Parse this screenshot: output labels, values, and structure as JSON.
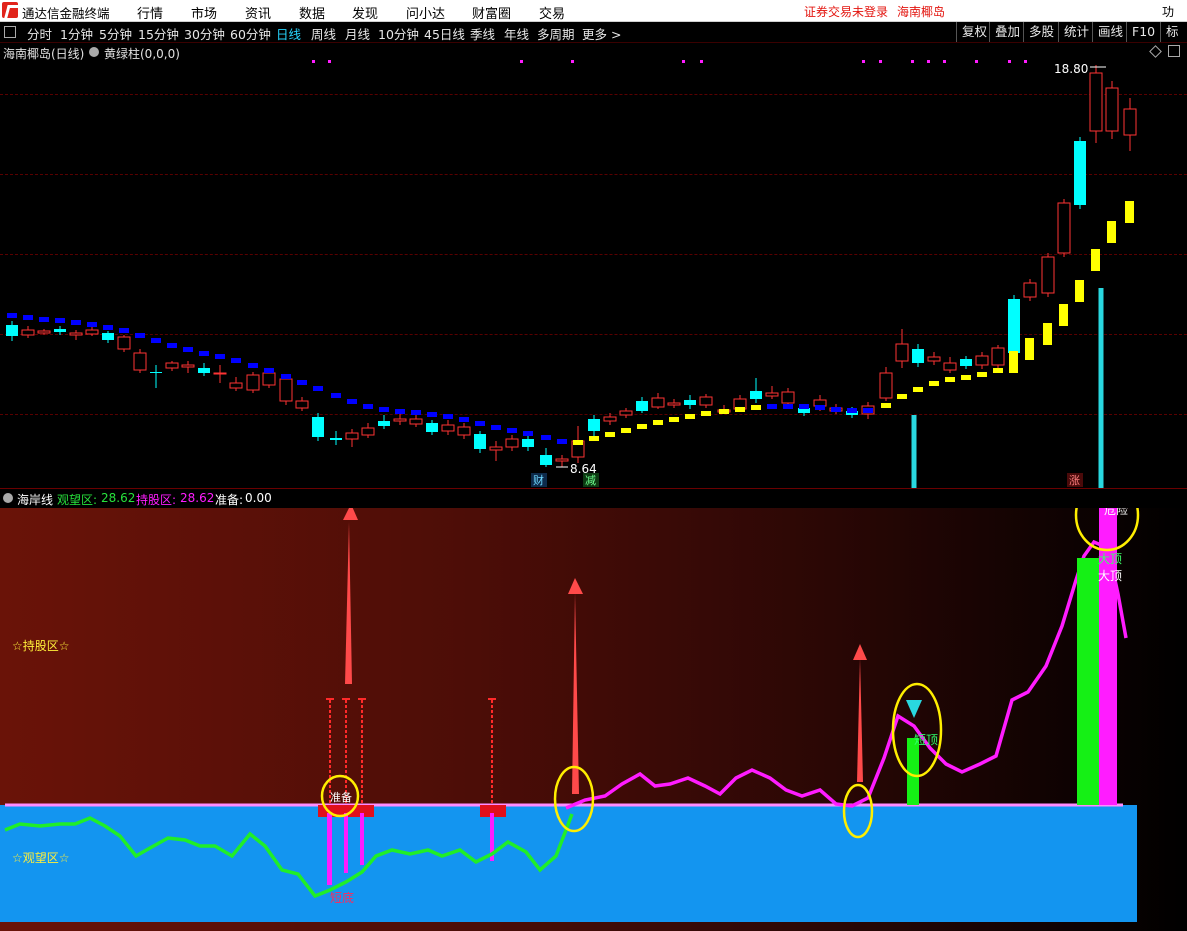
{
  "app": {
    "title": "通达信金融终端",
    "menu": [
      "行情",
      "市场",
      "资讯",
      "数据",
      "发现",
      "问小达",
      "财富圈",
      "交易"
    ],
    "warning": "证券交易未登录",
    "stock_name": "海南椰岛",
    "right_cut": "功"
  },
  "periods": [
    "分时",
    "1分钟",
    "5分钟",
    "15分钟",
    "30分钟",
    "60分钟",
    "日线",
    "周线",
    "月线",
    "10分钟",
    "45日线",
    "季线",
    "年线",
    "多周期",
    "更多 >"
  ],
  "active_period": "日线",
  "toolbar_right": [
    "复权",
    "叠加",
    "多股",
    "统计",
    "画线",
    "F10",
    "标记"
  ],
  "upper_panel": {
    "title": "海南椰岛(日线)",
    "indicator": "黄绿柱(0,0,0)",
    "high_price": "18.80",
    "low_price": "8.64",
    "markers": [
      "财",
      "减",
      "涨"
    ]
  },
  "lower_panel": {
    "name": "海岸线",
    "watch_label": "观望区:",
    "watch_value": "28.62",
    "hold_label": "持股区:",
    "hold_value": "28.62",
    "ready_label": "准备:",
    "ready_value": "0.00",
    "hold_zone": "☆持股区☆",
    "watch_zone": "☆观望区☆",
    "short_bottom": "短底",
    "short_top": "短顶",
    "big_top": "大顶",
    "danger": "危险",
    "ready_marker": "准备"
  },
  "colors": {
    "up": "#ff3333",
    "down": "#00ffff",
    "blue_line": "#0000ff",
    "yellow_line": "#ffff00",
    "magenta": "#ff1cff",
    "green": "#1bff1b",
    "watch_zone": "#1395f0",
    "circle": "#ffff00",
    "arrow_red": "#ff3a3a",
    "arrow_cyan": "#29d8e0"
  }
}
